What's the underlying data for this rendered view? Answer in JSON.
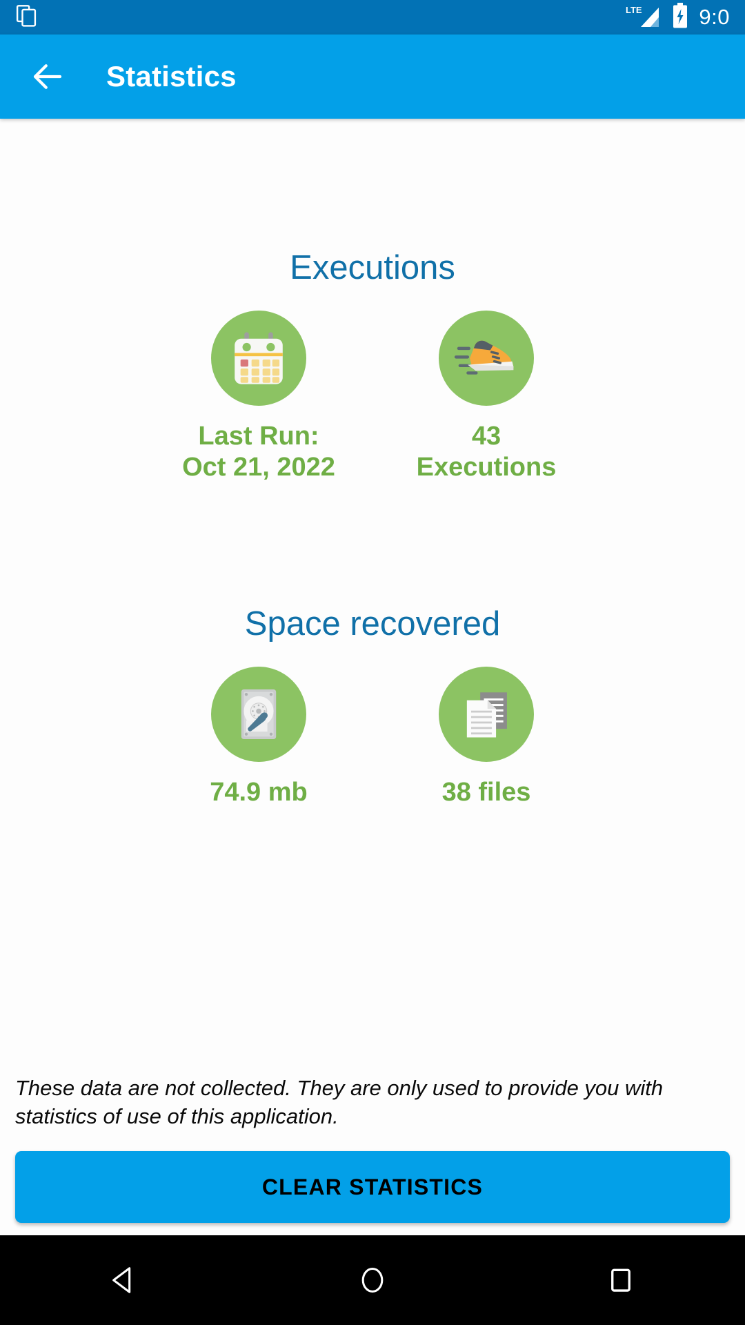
{
  "status_bar": {
    "left_icon": "copy-windows-icon",
    "network_label": "LTE",
    "signal_icon": "signal-bars-icon",
    "battery_icon": "battery-charging-icon",
    "time": "9:0",
    "background_color": "#0272B5"
  },
  "app_bar": {
    "back_icon": "arrow-left-icon",
    "title": "Statistics",
    "background_color": "#03A0E8",
    "text_color": "#FFFFFF"
  },
  "theme": {
    "accent_blue": "#03A0E8",
    "heading_blue": "#1070A8",
    "circle_green": "#8CC363",
    "label_green": "#6FAE45",
    "page_background": "#FDFDFD"
  },
  "sections": [
    {
      "id": "executions",
      "title": "Executions",
      "cards": [
        {
          "id": "last-run",
          "icon": "calendar-icon",
          "label": "Last Run:\nOct 21, 2022"
        },
        {
          "id": "executions-count",
          "icon": "running-shoe-icon",
          "label": "43\nExecutions"
        }
      ]
    },
    {
      "id": "space-recovered",
      "title": "Space recovered",
      "cards": [
        {
          "id": "space-freed",
          "icon": "hard-drive-icon",
          "label": "74.9 mb"
        },
        {
          "id": "files-cleaned",
          "icon": "documents-icon",
          "label": "38 files"
        }
      ]
    }
  ],
  "footer": {
    "disclaimer": "These data are not collected. They are only used to provide you with statistics of use of this application.",
    "clear_button_label": "CLEAR STATISTICS"
  },
  "nav_bar": {
    "back_label": "back-triangle-icon",
    "home_label": "home-circle-icon",
    "recents_label": "recents-square-icon"
  }
}
